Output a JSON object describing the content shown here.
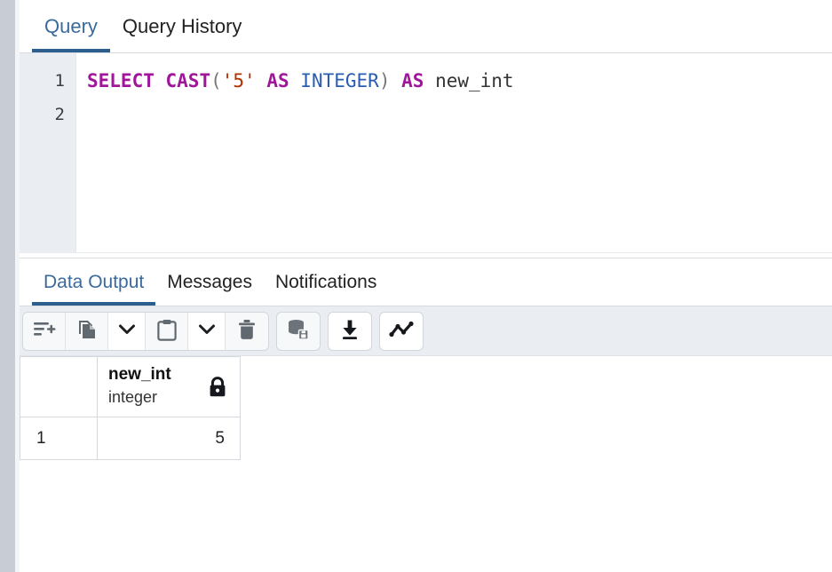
{
  "window": {
    "app": "pgAdmin Query Tool"
  },
  "top_tabs": {
    "items": [
      {
        "label": "Query",
        "active": true,
        "name": "tab-query"
      },
      {
        "label": "Query History",
        "active": false,
        "name": "tab-query-history"
      }
    ]
  },
  "editor": {
    "line_numbers": [
      "1",
      "2"
    ],
    "query_text": "SELECT CAST('5' AS INTEGER) AS new_int",
    "tokens": [
      {
        "text": "SELECT",
        "type": "keyword"
      },
      {
        "text": " ",
        "type": "plain"
      },
      {
        "text": "CAST",
        "type": "keyword"
      },
      {
        "text": "(",
        "type": "punct"
      },
      {
        "text": "'5'",
        "type": "string"
      },
      {
        "text": " ",
        "type": "plain"
      },
      {
        "text": "AS",
        "type": "keyword"
      },
      {
        "text": " ",
        "type": "plain"
      },
      {
        "text": "INTEGER",
        "type": "type"
      },
      {
        "text": ")",
        "type": "punct"
      },
      {
        "text": " ",
        "type": "plain"
      },
      {
        "text": "AS",
        "type": "keyword"
      },
      {
        "text": " ",
        "type": "plain"
      },
      {
        "text": "new_int",
        "type": "identifier"
      }
    ]
  },
  "output_tabs": {
    "items": [
      {
        "label": "Data Output",
        "active": true,
        "name": "tab-data-output"
      },
      {
        "label": "Messages",
        "active": false,
        "name": "tab-messages"
      },
      {
        "label": "Notifications",
        "active": false,
        "name": "tab-notifications"
      }
    ]
  },
  "toolbar": {
    "buttons": [
      {
        "name": "add-row-button",
        "icon": "add-row-icon",
        "enabled": true
      },
      {
        "name": "copy-button",
        "icon": "copy-icon",
        "enabled": true
      },
      {
        "name": "copy-options-dropdown",
        "icon": "chevron-down-icon",
        "enabled": true
      },
      {
        "name": "paste-button",
        "icon": "clipboard-paste-icon",
        "enabled": true
      },
      {
        "name": "paste-options-dropdown",
        "icon": "chevron-down-icon",
        "enabled": true
      },
      {
        "name": "delete-row-button",
        "icon": "trash-icon",
        "enabled": true
      },
      {
        "name": "save-data-changes-button",
        "icon": "database-save-icon",
        "enabled": false
      },
      {
        "name": "download-results-button",
        "icon": "download-icon",
        "enabled": true
      },
      {
        "name": "graph-visualiser-button",
        "icon": "line-chart-icon",
        "enabled": true
      }
    ]
  },
  "grid": {
    "columns": [
      {
        "name": "new_int",
        "type": "integer",
        "readonly": true,
        "lock_icon": "lock-icon"
      }
    ],
    "rows": [
      {
        "rownum": "1",
        "values": [
          "5"
        ]
      }
    ]
  },
  "colors": {
    "accent": "#2c5f8e",
    "active_tab_text": "#3a6a9c",
    "keyword": "#a0169b",
    "type_keyword": "#2a5db0",
    "string_literal": "#b03000",
    "toolbar_bg": "#eaedf1",
    "gutter_bg": "#eaedf1",
    "rail": "#c8ccd4",
    "grid_border": "#d5d8dd"
  }
}
